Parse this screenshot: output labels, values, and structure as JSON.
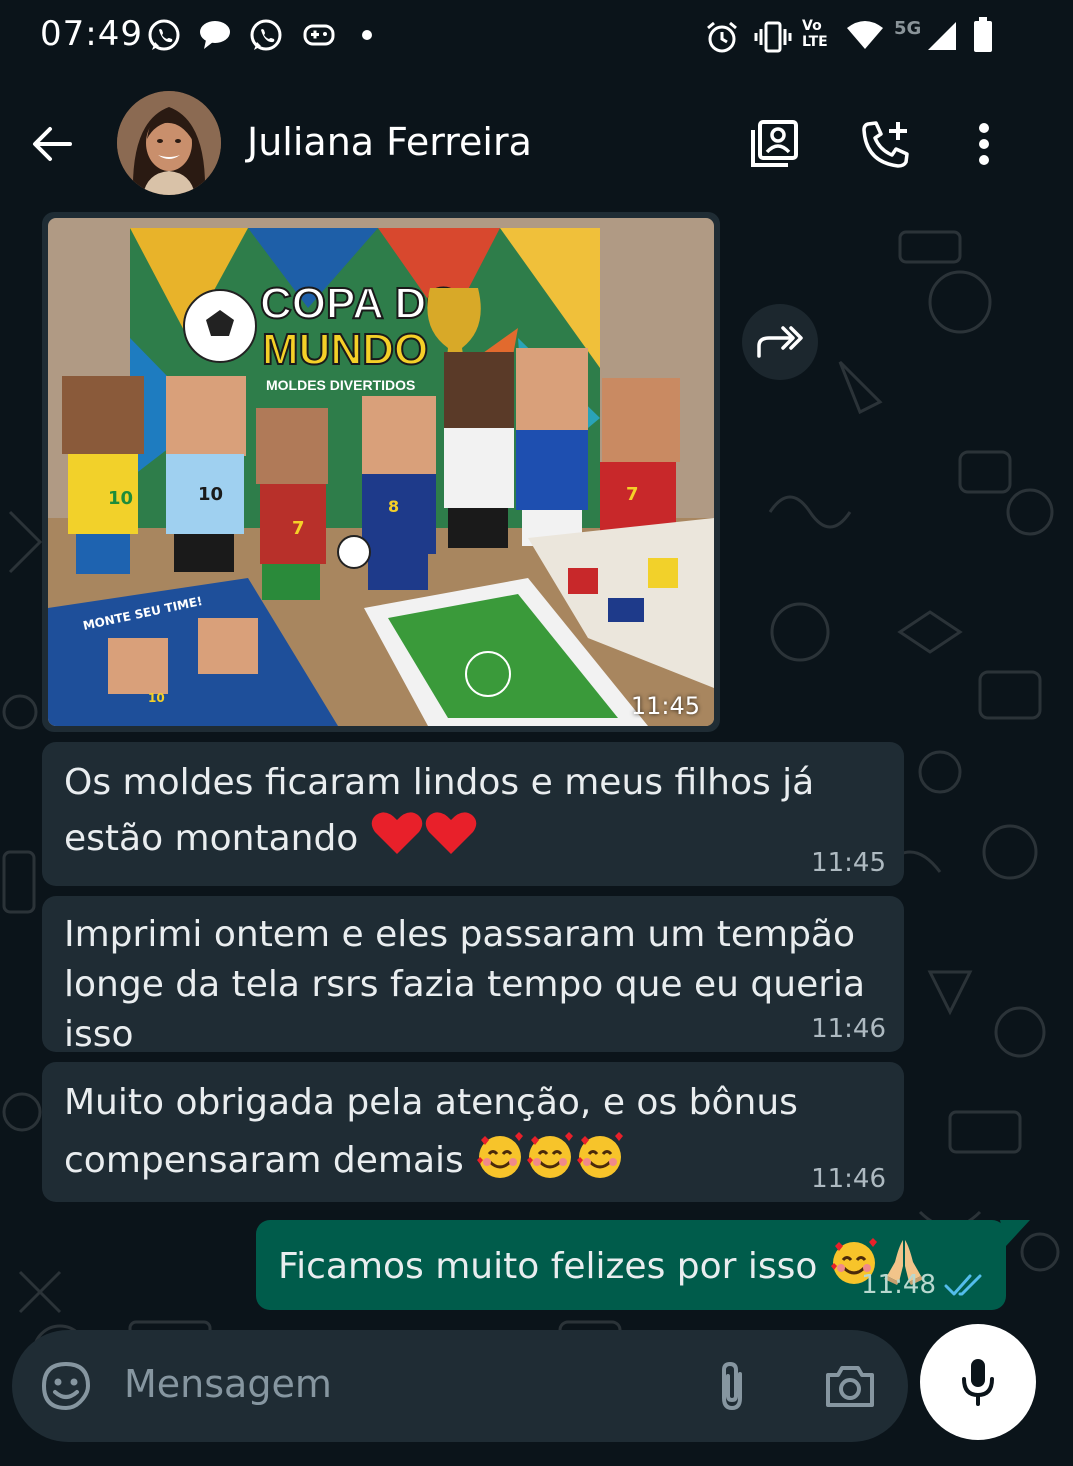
{
  "status_bar": {
    "time": "07:49",
    "network_label": "5G",
    "volte_label_1": "Vo",
    "volte_label_2": "LTE"
  },
  "header": {
    "contact_name": "Juliana Ferreira",
    "icons": [
      "back-arrow-icon",
      "contact-card-icon",
      "add-call-icon",
      "more-vert-icon"
    ]
  },
  "messages": [
    {
      "type": "image",
      "direction": "incoming",
      "time": "11:45",
      "image_text": {
        "title_line_1": "COPA DO",
        "title_line_2": "MUNDO",
        "subtitle": "MOLDES DIVERTIDOS",
        "poster_text": "MONTE SEU TIME!",
        "jersey_numbers": [
          "10",
          "10",
          "7",
          "8",
          "7",
          "10"
        ]
      }
    },
    {
      "type": "text",
      "direction": "incoming",
      "line1": "Os moldes ficaram lindos e meus filhos já",
      "line2": "estão montando",
      "emoji": [
        "heart",
        "heart"
      ],
      "time": "11:45"
    },
    {
      "type": "text",
      "direction": "incoming",
      "line1": "Imprimi ontem e eles passaram um tempão",
      "line2": "longe da tela rsrs fazia tempo que eu queria isso",
      "time": "11:46"
    },
    {
      "type": "text",
      "direction": "incoming",
      "line1": "Muito obrigada pela atenção, e os bônus",
      "line2": "compensaram demais",
      "emoji": [
        "smiling-face-with-hearts",
        "smiling-face-with-hearts",
        "smiling-face-with-hearts"
      ],
      "time": "11:46"
    },
    {
      "type": "text",
      "direction": "outgoing",
      "line1": "Ficamos muito felizes por isso",
      "emoji": [
        "smiling-face-with-hearts",
        "folded-hands"
      ],
      "time": "11:48",
      "status": "read"
    }
  ],
  "composer": {
    "placeholder": "Mensagem"
  },
  "colors": {
    "background": "#0b141a",
    "incoming_bubble": "#1f2c34",
    "outgoing_bubble": "#005c4b",
    "read_ticks": "#53bdeb"
  }
}
